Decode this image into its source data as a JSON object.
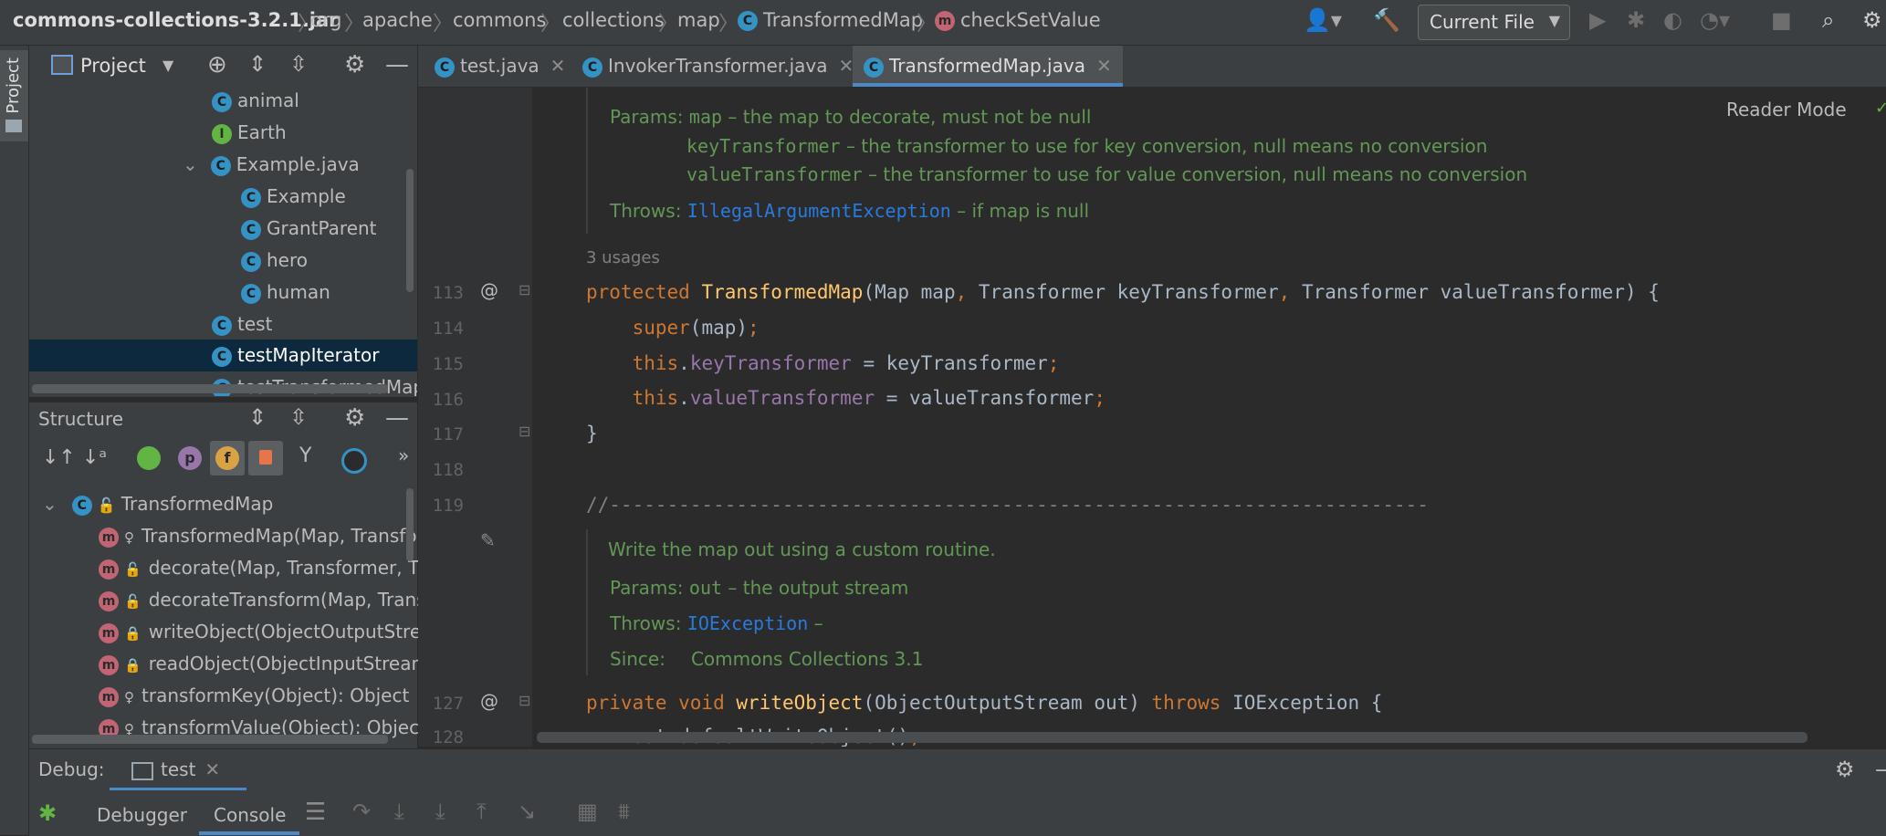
{
  "breadcrumb": {
    "jar": "commons-collections-3.2.1.jar",
    "parts": [
      "org",
      "apache",
      "commons",
      "collections",
      "map"
    ],
    "class": "TransformedMap",
    "method": "checkSetValue"
  },
  "toolbar": {
    "run_config": "Current File"
  },
  "left_stripe": {
    "project_tab": "Project"
  },
  "project_panel": {
    "title": "Project",
    "items": [
      {
        "label": "animal",
        "kind": "class"
      },
      {
        "label": "Earth",
        "kind": "interface"
      },
      {
        "label": "Example.java",
        "kind": "class"
      },
      {
        "label": "Example",
        "kind": "class"
      },
      {
        "label": "GrantParent",
        "kind": "class"
      },
      {
        "label": "hero",
        "kind": "class"
      },
      {
        "label": "human",
        "kind": "class"
      },
      {
        "label": "test",
        "kind": "class"
      },
      {
        "label": "testMapIterator",
        "kind": "class"
      },
      {
        "label": "testTransformedMap",
        "kind": "class"
      }
    ]
  },
  "structure_panel": {
    "title": "Structure",
    "root": "TransformedMap",
    "items": [
      "TransformedMap(Map, Transfor",
      "decorate(Map, Transformer, Tra",
      "decorateTransform(Map, Transf",
      "writeObject(ObjectOutputStrear",
      "readObject(ObjectInputStream)",
      "transformKey(Object): Object",
      "transformValue(Object): Object"
    ]
  },
  "tabs": [
    {
      "label": "test.java",
      "active": false
    },
    {
      "label": "InvokerTransformer.java",
      "active": false
    },
    {
      "label": "TransformedMap.java",
      "active": true
    }
  ],
  "editor": {
    "reader_mode": "Reader Mode",
    "doc1": {
      "params_label": "Params:",
      "p1_name": "map",
      "p1_desc": "– the map to decorate, must not be null",
      "p2_name": "keyTransformer",
      "p2_desc": "– the transformer to use for key conversion, null means no conversion",
      "p3_name": "valueTransformer",
      "p3_desc": "– the transformer to use for value conversion, null means no conversion",
      "throws_label": "Throws:",
      "throws_name": "IllegalArgumentException",
      "throws_desc": "– if map is null"
    },
    "usages": "3 usages",
    "lines": {
      "l113": "113",
      "l114": "114",
      "l115": "115",
      "l116": "116",
      "l117": "117",
      "l118": "118",
      "l119": "119",
      "l127": "127",
      "l128": "128"
    },
    "doc2": {
      "summary": "Write the map out using a custom routine.",
      "params_label": "Params:",
      "p1_name": "out",
      "p1_desc": "– the output stream",
      "throws_label": "Throws:",
      "throws_name": "IOException",
      "throws_desc": "–",
      "since_label": "Since:",
      "since_value": "Commons Collections 3.1"
    }
  },
  "debug": {
    "label": "Debug:",
    "session": "test",
    "tabs": [
      "Debugger",
      "Console"
    ]
  }
}
